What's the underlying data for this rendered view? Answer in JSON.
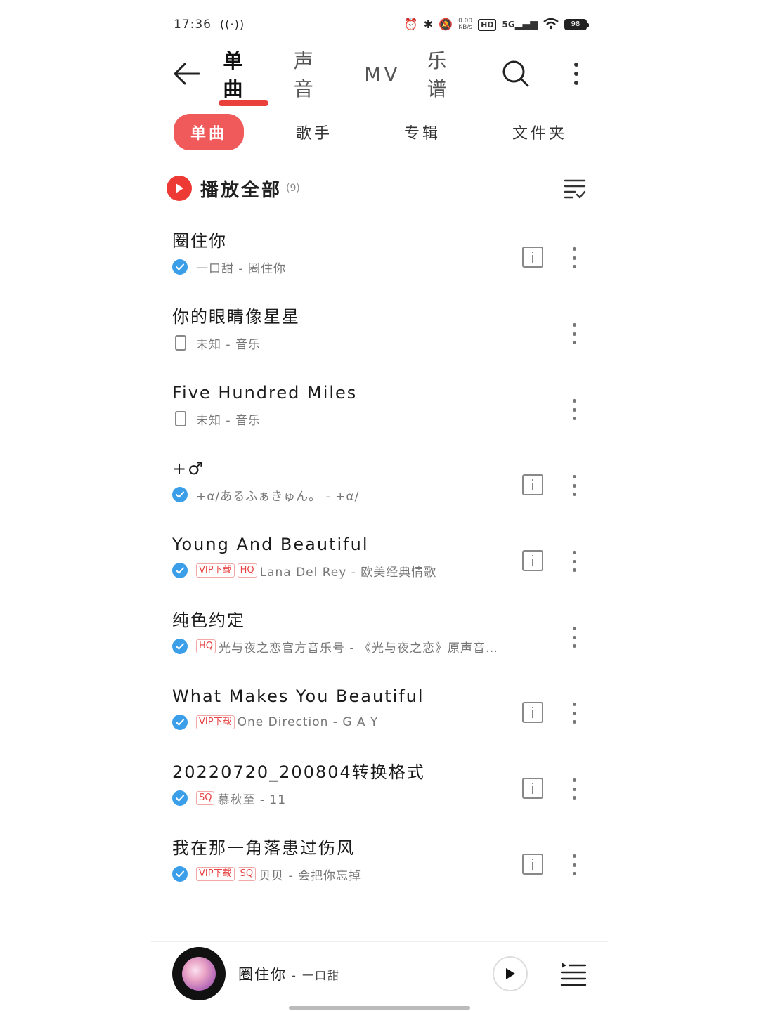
{
  "status_bar": {
    "time": "17:36",
    "net_speed_top": "0.00",
    "net_speed_unit": "KB/s",
    "hd_label": "HD",
    "signal_label": "5G",
    "battery": "98"
  },
  "top_nav": {
    "tabs": [
      {
        "label": "单曲",
        "active": true
      },
      {
        "label": "声音",
        "active": false
      },
      {
        "label": "MV",
        "active": false
      },
      {
        "label": "乐谱",
        "active": false
      }
    ]
  },
  "sub_tabs": [
    {
      "label": "单曲",
      "active": true
    },
    {
      "label": "歌手",
      "active": false
    },
    {
      "label": "专辑",
      "active": false
    },
    {
      "label": "文件夹",
      "active": false
    }
  ],
  "play_all": {
    "label": "播放全部",
    "count": "(9)"
  },
  "songs": [
    {
      "title": "圈住你",
      "subtitle": "一口甜 - 圈住你",
      "source": "verified",
      "tags": [],
      "has_info": true
    },
    {
      "title": "你的眼睛像星星",
      "subtitle": "未知 - 音乐",
      "source": "local",
      "tags": [],
      "has_info": false
    },
    {
      "title": "Five Hundred Miles",
      "subtitle": "未知 - 音乐",
      "source": "local",
      "tags": [],
      "has_info": false
    },
    {
      "title": "+♂",
      "subtitle": "+α/あるふぁきゅん。 - +α/",
      "source": "verified",
      "tags": [],
      "has_info": true
    },
    {
      "title": "Young And Beautiful",
      "subtitle": "Lana Del Rey - 欧美经典情歌",
      "source": "verified",
      "tags": [
        "VIP下载",
        "HQ"
      ],
      "has_info": true
    },
    {
      "title": "纯色约定",
      "subtitle": "光与夜之恋官方音乐号 - 《光与夜之恋》原声音…",
      "source": "verified",
      "tags": [
        "HQ"
      ],
      "has_info": false
    },
    {
      "title": "What Makes You Beautiful",
      "subtitle": "One Direction - G A Y",
      "source": "verified",
      "tags": [
        "VIP下载"
      ],
      "has_info": true
    },
    {
      "title": "20220720_200804转换格式",
      "subtitle": "慕秋至 - 11",
      "source": "verified",
      "tags": [
        "SQ"
      ],
      "has_info": true
    },
    {
      "title": "我在那一角落患过伤风",
      "subtitle": "贝贝 - 会把你忘掉",
      "source": "verified",
      "tags": [
        "VIP下载",
        "SQ"
      ],
      "has_info": true
    }
  ],
  "now_playing": {
    "title": "圈住你",
    "separator": " - ",
    "artist": "一口甜"
  }
}
